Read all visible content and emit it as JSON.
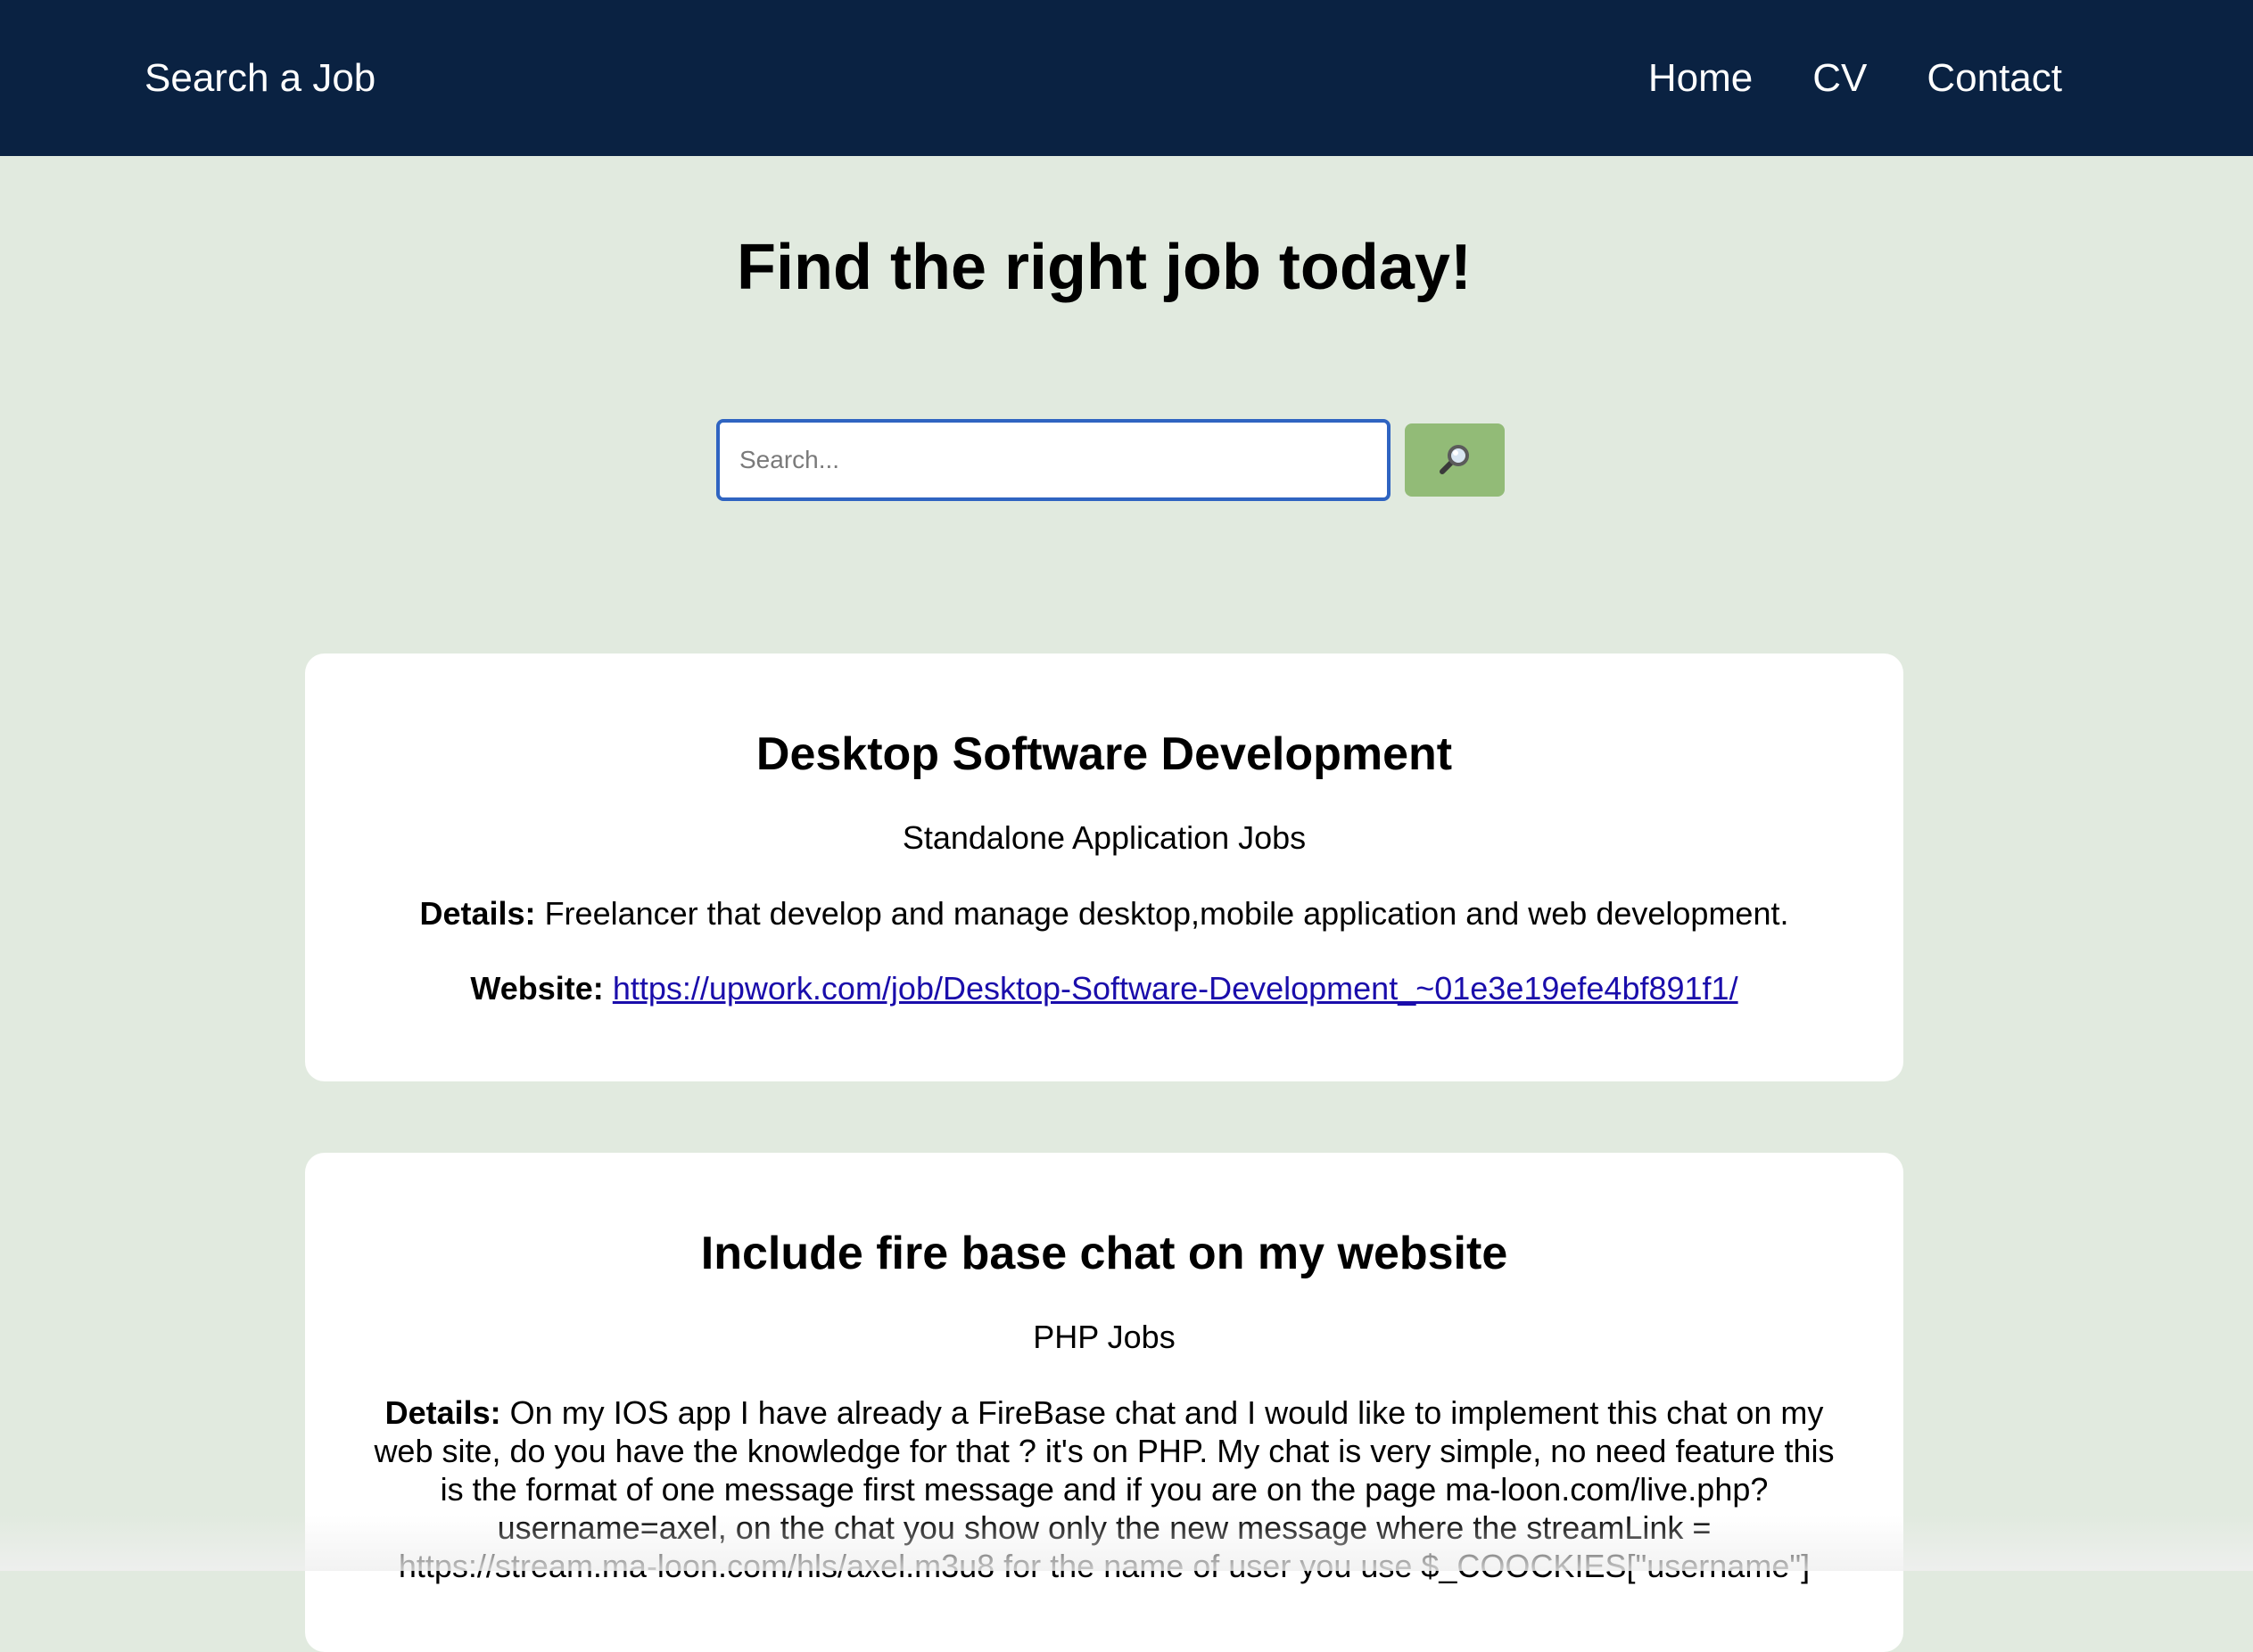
{
  "nav": {
    "brand": "Search a Job",
    "links": [
      "Home",
      "CV",
      "Contact"
    ]
  },
  "hero": {
    "title": "Find the right job today!"
  },
  "search": {
    "placeholder": "Search...",
    "button_icon": "magnifier-icon"
  },
  "jobs": [
    {
      "title": "Desktop Software Development",
      "category": "Standalone Application Jobs",
      "details_label": "Details:",
      "details": "Freelancer that develop and manage desktop,mobile application and web development.",
      "website_label": "Website:",
      "website": "https://upwork.com/job/Desktop-Software-Development_~01e3e19efe4bf891f1/"
    },
    {
      "title": "Include fire base chat on my website",
      "category": "PHP Jobs",
      "details_label": "Details:",
      "details": "On my IOS app I have already a FireBase chat and I would like to implement this chat on my web site, do you have the knowledge for that ? it's on PHP. My chat is very simple, no need feature this is the format of one message first message and if you are on the page ma-loon.com/live.php?username=axel, on the chat you show only the new message where the streamLink = https://stream.ma-loon.com/hls/axel.m3u8 for the name of user you use $_COOCKIES[\"username\"]"
    }
  ],
  "colors": {
    "navbar": "#0a2242",
    "background": "#e1eadf",
    "search_border": "#2f64c1",
    "search_button": "#92bb77",
    "link": "#1a0dab"
  }
}
